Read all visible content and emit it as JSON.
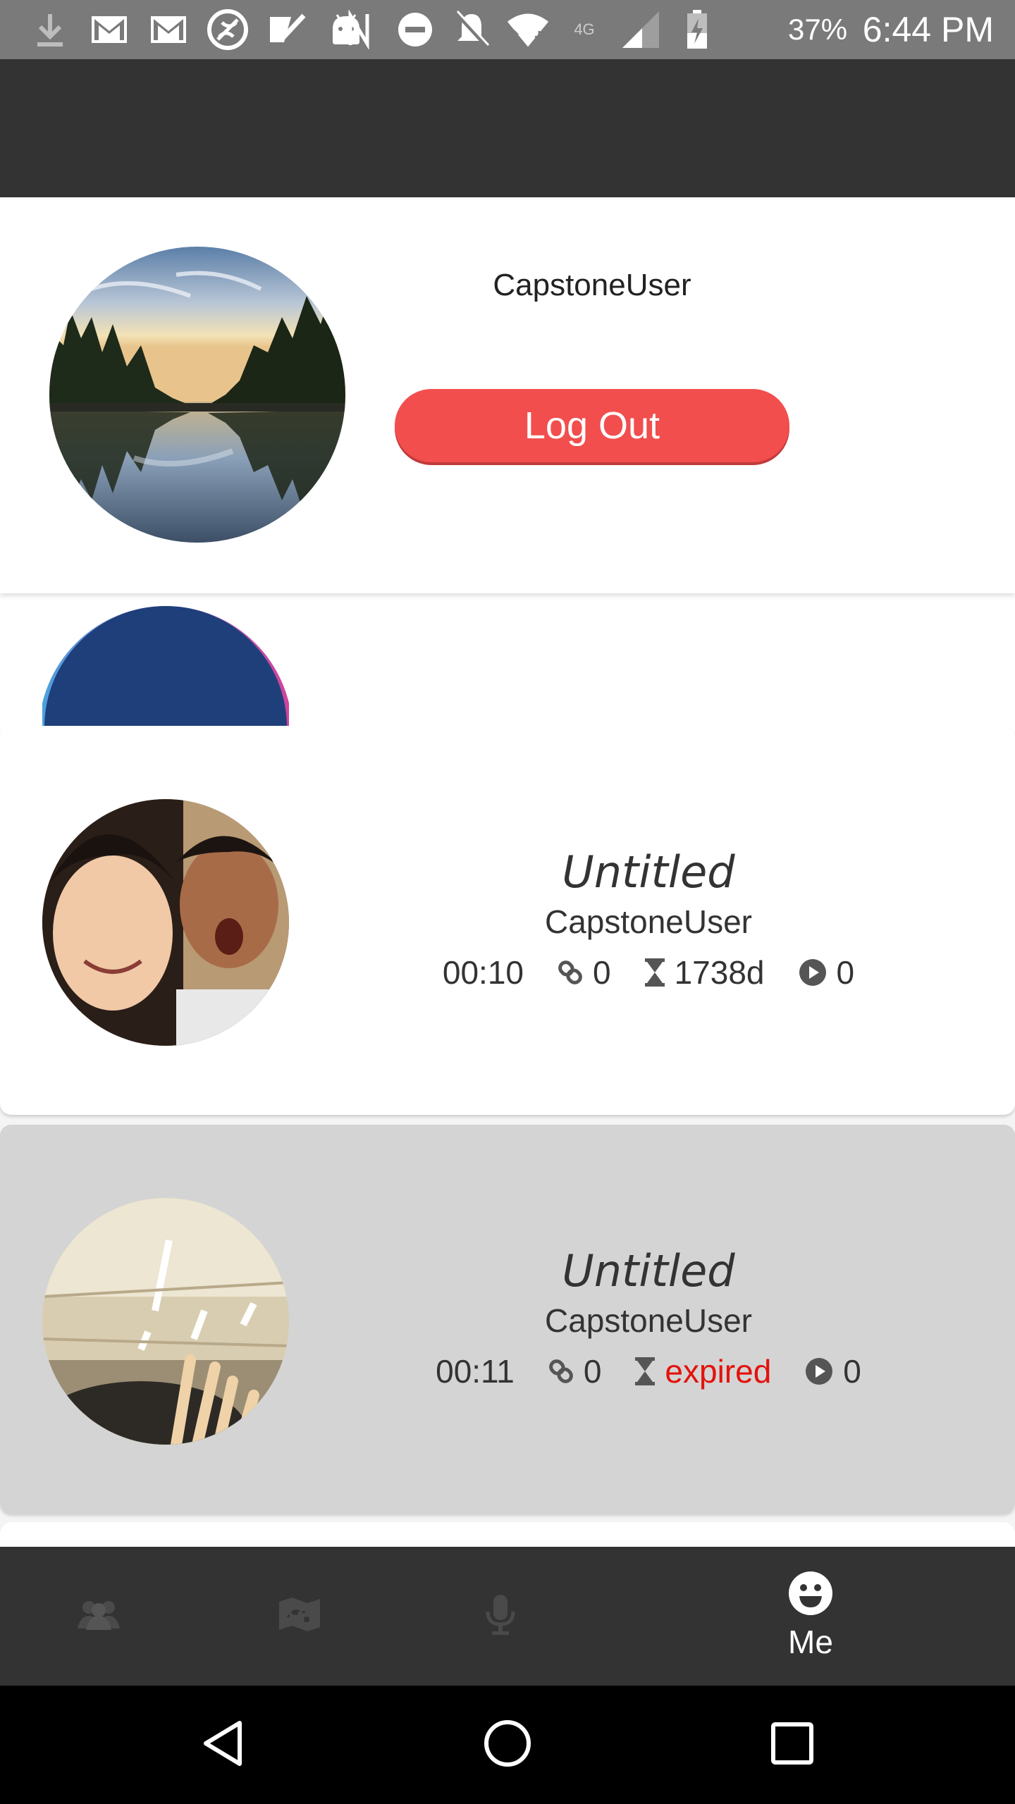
{
  "status_bar": {
    "battery_percent": "37%",
    "time": "6:44 PM",
    "icons_left": [
      "download-icon",
      "gmail-icon",
      "gmail-icon",
      "vpn-icon",
      "check-icon",
      "android-icon"
    ],
    "icons_right": [
      "nfc-icon",
      "do-not-disturb-icon",
      "notifications-off-icon",
      "wifi-icon",
      "signal-icon",
      "battery-icon"
    ],
    "network_label": "4G"
  },
  "profile": {
    "username": "CapstoneUser",
    "logout_label": "Log Out"
  },
  "posts": [
    {
      "title": "Untitled",
      "author": "CapstoneUser",
      "duration": "00:10",
      "links": "0",
      "remaining": "1738d",
      "plays": "0",
      "expired": false
    },
    {
      "title": "Untitled",
      "author": "CapstoneUser",
      "duration": "00:11",
      "links": "0",
      "remaining": "expired",
      "plays": "0",
      "expired": true
    }
  ],
  "bottom_nav": {
    "items": [
      {
        "icon": "people-icon",
        "label": ""
      },
      {
        "icon": "map-icon",
        "label": ""
      },
      {
        "icon": "microphone-icon",
        "label": ""
      },
      {
        "icon": "smiley-icon",
        "label": "Me"
      }
    ]
  },
  "colors": {
    "app_bar": "#333333",
    "logout_button": "#f24e4e",
    "expired_text": "#e3120b",
    "selected_card": "#d4d4d4"
  }
}
